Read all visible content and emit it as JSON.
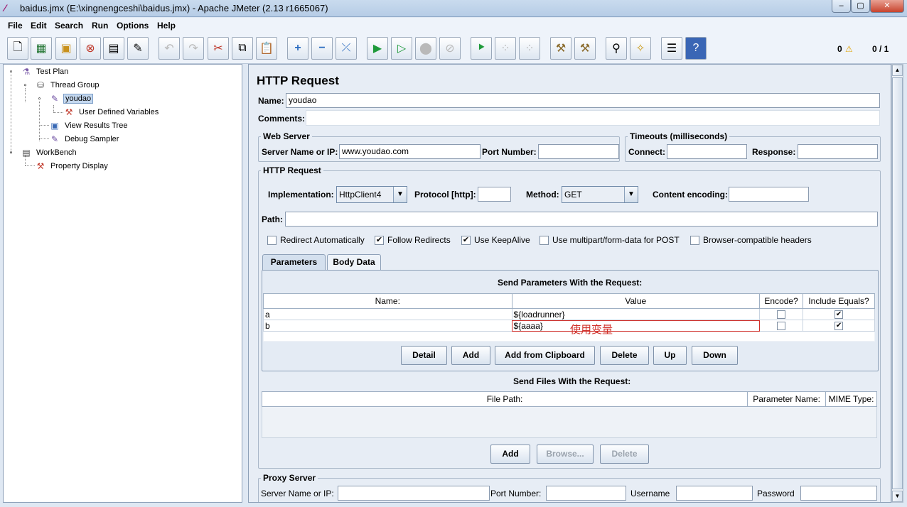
{
  "window": {
    "title": "baidus.jmx (E:\\xingnengceshi\\baidus.jmx) - Apache JMeter (2.13 r1665067)",
    "min": "‒",
    "max": "▢",
    "close": "✕"
  },
  "menu": [
    "File",
    "Edit",
    "Search",
    "Run",
    "Options",
    "Help"
  ],
  "toolbar": {
    "icons": [
      "new-icon",
      "templates-icon",
      "open-icon",
      "close-icon",
      "save-icon",
      "save-as-icon",
      "undo-icon",
      "redo-icon",
      "cut-icon",
      "copy-icon",
      "paste-icon",
      "expand-icon",
      "collapse-icon",
      "toggle-icon",
      "start-icon",
      "start-no-pause-icon",
      "stop-icon",
      "shutdown-icon",
      "remote-start-icon",
      "remote-stop-icon",
      "remote-shutdown-icon",
      "clear-icon",
      "clear-all-icon",
      "search-icon",
      "reset-search-icon",
      "function-helper-icon",
      "help-icon"
    ],
    "error_count": "0",
    "threads": "0 / 1"
  },
  "tree": {
    "nodes": [
      {
        "label": "Test Plan"
      },
      {
        "label": "Thread Group"
      },
      {
        "label": "youdao"
      },
      {
        "label": "User Defined Variables"
      },
      {
        "label": "View Results Tree"
      },
      {
        "label": "Debug Sampler"
      },
      {
        "label": "WorkBench"
      },
      {
        "label": "Property Display"
      }
    ]
  },
  "panel": {
    "title": "HTTP Request",
    "name_label": "Name:",
    "name_value": "youdao",
    "comments_label": "Comments:",
    "web_server": {
      "title": "Web Server",
      "server_label": "Server Name or IP:",
      "server_value": "www.youdao.com",
      "port_label": "Port Number:",
      "port_value": ""
    },
    "timeouts": {
      "title": "Timeouts (milliseconds)",
      "connect_label": "Connect:",
      "response_label": "Response:"
    },
    "http_request": {
      "title": "HTTP Request",
      "impl_label": "Implementation:",
      "impl_value": "HttpClient4",
      "protocol_label": "Protocol [http]:",
      "method_label": "Method:",
      "method_value": "GET",
      "encoding_label": "Content encoding:",
      "path_label": "Path:",
      "checks": [
        {
          "label": "Redirect Automatically",
          "checked": false
        },
        {
          "label": "Follow Redirects",
          "checked": true
        },
        {
          "label": "Use KeepAlive",
          "checked": true
        },
        {
          "label": "Use multipart/form-data for POST",
          "checked": false
        },
        {
          "label": "Browser-compatible headers",
          "checked": false
        }
      ]
    },
    "tabs": [
      "Parameters",
      "Body Data"
    ],
    "params": {
      "title": "Send Parameters With the Request:",
      "headers": [
        "Name:",
        "Value",
        "Encode?",
        "Include Equals?"
      ],
      "rows": [
        {
          "name": "a",
          "value": "${loadrunner}",
          "encode": false,
          "include_equals": true
        },
        {
          "name": "b",
          "value": "${aaaa}",
          "encode": false,
          "include_equals": true
        }
      ],
      "annotation": "使用变量",
      "buttons": [
        "Detail",
        "Add",
        "Add from Clipboard",
        "Delete",
        "Up",
        "Down"
      ]
    },
    "files": {
      "title": "Send Files With the Request:",
      "headers": [
        "File Path:",
        "Parameter Name:",
        "MIME Type:"
      ],
      "buttons": [
        "Add",
        "Browse...",
        "Delete"
      ]
    },
    "proxy": {
      "title": "Proxy Server",
      "server_label": "Server Name or IP:",
      "port_label": "Port Number:",
      "username_label": "Username",
      "password_label": "Password"
    }
  }
}
